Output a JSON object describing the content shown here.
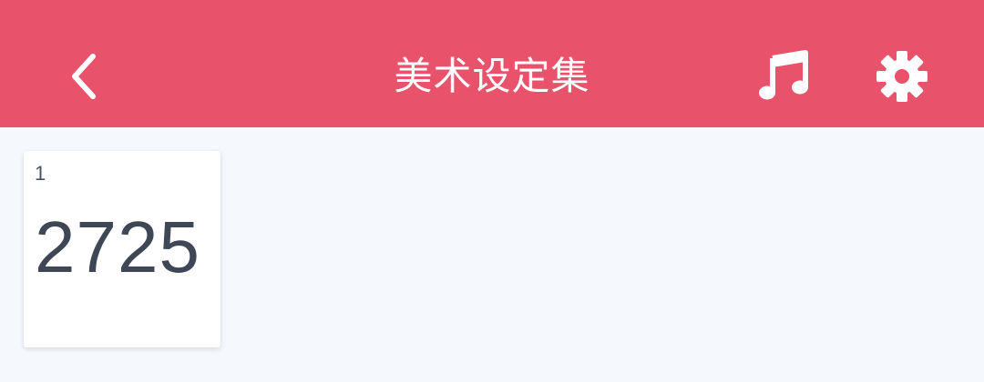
{
  "app_bar": {
    "title": "美术设定集",
    "background_color": "#e9526b",
    "back_icon": "chevron-left-icon",
    "music_icon": "music-note-icon",
    "settings_icon": "gear-icon"
  },
  "cards": [
    {
      "index": "1",
      "value": "2725"
    }
  ],
  "colors": {
    "page_background": "#f5f9fd",
    "card_background": "#ffffff",
    "card_text": "#3f4756"
  }
}
